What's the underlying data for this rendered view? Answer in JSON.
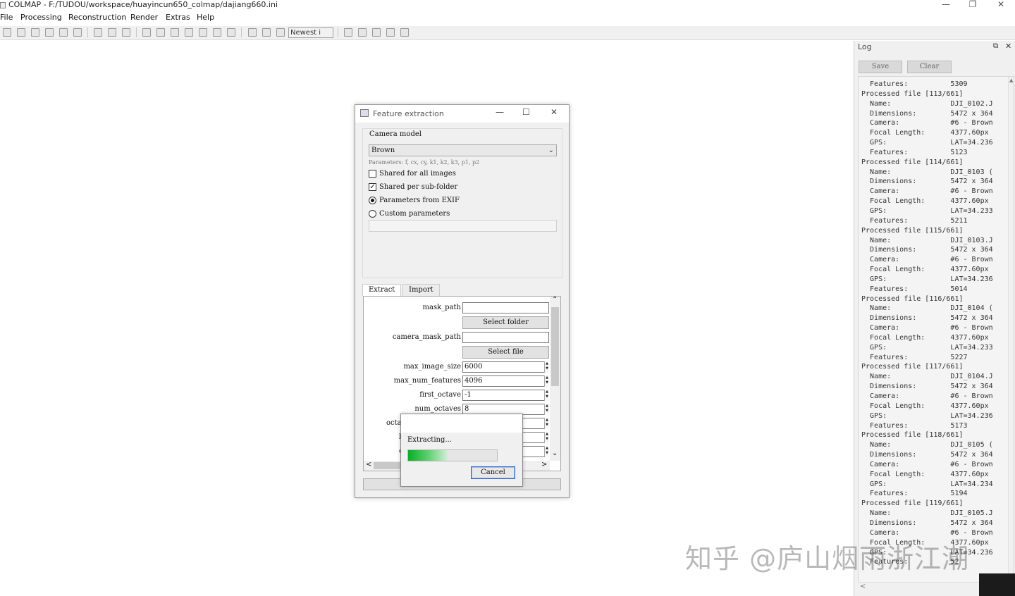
{
  "window": {
    "title": "COLMAP - F:/TUDOU/workspace/huayincun650_colmap/dajiang660.ini",
    "controls": {
      "minimize": "—",
      "maximize": "❐",
      "close": "✕"
    }
  },
  "menu": [
    "File",
    "Processing",
    "Reconstruction",
    "Render",
    "Extras",
    "Help"
  ],
  "toolbar": {
    "render_combo": "Newest i"
  },
  "log": {
    "title": "Log",
    "float_icon": "⧉",
    "close_icon": "✕",
    "save_label": "Save",
    "clear_label": "Clear",
    "lines": [
      "  Features:          5309",
      "Processed file [113/661]",
      "  Name:              DJI_0102.J",
      "  Dimensions:        5472 x 364",
      "  Camera:            #6 - Brown",
      "  Focal Length:      4377.60px",
      "  GPS:               LAT=34.236",
      "  Features:          5123",
      "Processed file [114/661]",
      "  Name:              DJI_0103 (",
      "  Dimensions:        5472 x 364",
      "  Camera:            #6 - Brown",
      "  Focal Length:      4377.60px",
      "  GPS:               LAT=34.233",
      "  Features:          5211",
      "Processed file [115/661]",
      "  Name:              DJI_0103.J",
      "  Dimensions:        5472 x 364",
      "  Camera:            #6 - Brown",
      "  Focal Length:      4377.60px",
      "  GPS:               LAT=34.236",
      "  Features:          5014",
      "Processed file [116/661]",
      "  Name:              DJI_0104 (",
      "  Dimensions:        5472 x 364",
      "  Camera:            #6 - Brown",
      "  Focal Length:      4377.60px",
      "  GPS:               LAT=34.233",
      "  Features:          5227",
      "Processed file [117/661]",
      "  Name:              DJI_0104.J",
      "  Dimensions:        5472 x 364",
      "  Camera:            #6 - Brown",
      "  Focal Length:      4377.60px",
      "  GPS:               LAT=34.236",
      "  Features:          5173",
      "Processed file [118/661]",
      "  Name:              DJI_0105 (",
      "  Dimensions:        5472 x 364",
      "  Camera:            #6 - Brown",
      "  Focal Length:      4377.60px",
      "  GPS:               LAT=34.234",
      "  Features:          5194",
      "Processed file [119/661]",
      "  Name:              DJI_0105.J",
      "  Dimensions:        5472 x 364",
      "  Camera:            #6 - Brown",
      "  Focal Length:      4377.60px",
      "  GPS:               LAT=34.236",
      "  Features:          52"
    ],
    "scroll_up": "▲",
    "scroll_left": "<"
  },
  "dialog": {
    "title": "Feature extraction",
    "controls": {
      "minimize": "—",
      "maximize": "☐",
      "close": "✕"
    },
    "camera_group": "Camera model",
    "camera_model": "Brown",
    "parameters": "Parameters: f, cx, cy, k1, k2, k3, p1, p2",
    "shared_all_label": "Shared for all images",
    "shared_all_checked": false,
    "shared_sub_label": "Shared per sub-folder",
    "shared_sub_checked": true,
    "from_exif_label": "Parameters from EXIF",
    "from_exif_selected": true,
    "custom_label": "Custom parameters",
    "custom_selected": false,
    "tabs": [
      "Extract",
      "Import"
    ],
    "mask_path_label": "mask_path",
    "mask_path_value": "",
    "select_folder_label": "Select folder",
    "camera_mask_label": "camera_mask_path",
    "camera_mask_value": "",
    "select_file_label": "Select file",
    "max_image_size_label": "max_image_size",
    "max_image_size_value": "6000",
    "max_num_features_label": "max_num_features",
    "max_num_features_value": "4096",
    "first_octave_label": "first_octave",
    "first_octave_value": "-1",
    "num_octaves_label": "num_octaves",
    "num_octaves_value": "8",
    "octave_resolution_partial": "octa",
    "hidden_label_partial_1": "l",
    "hidden_label_partial_2": "c",
    "extract_button": "Extract",
    "spin_up": "▲",
    "spin_down": "▼",
    "scroll_up": "⌃",
    "scroll_down": "⌄",
    "scroll_left": "<",
    "scroll_right": ">"
  },
  "progress": {
    "label": "Extracting...",
    "value_fraction": 0.45,
    "cancel_label": "Cancel"
  },
  "watermark": "知乎 @庐山烟雨浙江潮",
  "colors": {
    "progress_green": "#06b025",
    "focus_blue": "#2a63c4"
  }
}
